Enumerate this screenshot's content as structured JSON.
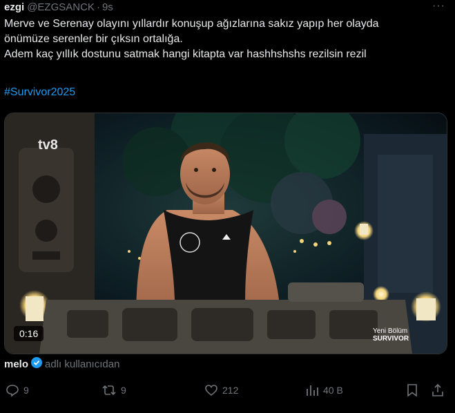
{
  "tweet": {
    "display_name": "ezgi",
    "handle": "@EZGSANCK",
    "separator": "·",
    "time": "9s",
    "more": "···",
    "lines": [
      "Merve ve Serenay olayını yıllardır konuşup ağızlarına sakız yapıp her olayda",
      "önümüze serenler bir çıksın ortalığa.",
      "Adem kaç yıllık dostunu satmak hangi kitapta var hashhshshs rezilsin rezil"
    ],
    "hashtag": "#Survivor2025"
  },
  "video": {
    "channel_logo": "tv8",
    "duration": "0:16",
    "ribbon_line1": "Yeni Bölüm",
    "ribbon_line2": "SURVIVOR"
  },
  "quote": {
    "name": "melo",
    "suffix": "adlı kullanıcıdan"
  },
  "actions": {
    "replies": "9",
    "reposts": "9",
    "likes": "212",
    "views": "40 B"
  },
  "colors": {
    "accent": "#1d9bf0",
    "muted": "#71767b",
    "text": "#e7e9ea"
  }
}
